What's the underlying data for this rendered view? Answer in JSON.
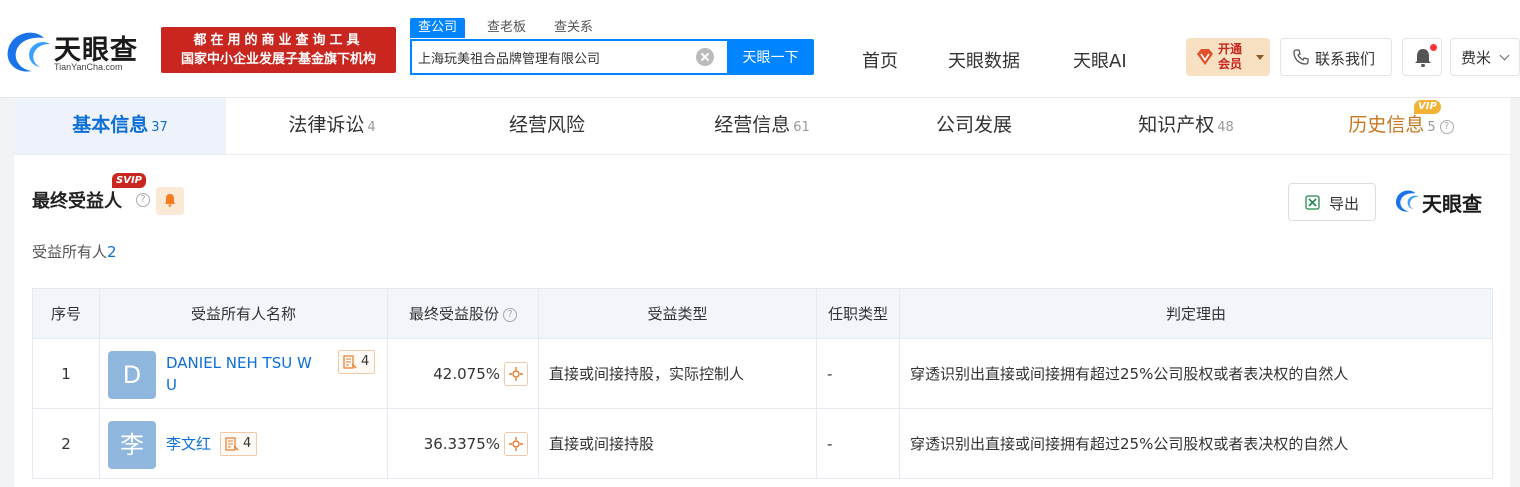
{
  "header": {
    "logo_text": "天眼查",
    "logo_sub": "TianYanCha.com",
    "slogan_line1": "都在用的商业查询工具",
    "slogan_line2": "国家中小企业发展子基金旗下机构",
    "search_tabs": [
      "查公司",
      "查老板",
      "查关系"
    ],
    "search_value": "上海玩美祖合品牌管理有限公司",
    "search_button": "天眼一下",
    "nav": [
      "首页",
      "天眼数据",
      "天眼AI"
    ],
    "vip_label": "开通会员",
    "contact_label": "联系我们",
    "user_label": "费米"
  },
  "tabs": [
    {
      "label": "基本信息",
      "count": "37"
    },
    {
      "label": "法律诉讼",
      "count": "4"
    },
    {
      "label": "经营风险",
      "count": ""
    },
    {
      "label": "经营信息",
      "count": "61"
    },
    {
      "label": "公司发展",
      "count": ""
    },
    {
      "label": "知识产权",
      "count": "48"
    },
    {
      "label": "历史信息",
      "count": "5",
      "tag": "VIP"
    }
  ],
  "section": {
    "title": "最终受益人",
    "tag": "SVIP",
    "export_label": "导出",
    "brand_text": "天眼查",
    "owner_count_label": "受益所有人",
    "owner_count": "2"
  },
  "table": {
    "headers": [
      "序号",
      "受益所有人名称",
      "最终受益股份",
      "受益类型",
      "任职类型",
      "判定理由"
    ],
    "rows": [
      {
        "index": "1",
        "avatar": "D",
        "avatar_color": "#8fb6dd",
        "name_line1": "DANIEL NEH TSU W",
        "name_line2": "U",
        "cases": "4",
        "share": "42.075%",
        "benefit_type": "直接或间接持股，实际控制人",
        "position_type": "-",
        "reason": "穿透识别出直接或间接拥有超过25%公司股权或者表决权的自然人"
      },
      {
        "index": "2",
        "avatar": "李",
        "avatar_color": "#8fb6dd",
        "name_line1": "李文红",
        "name_line2": "",
        "cases": "4",
        "share": "36.3375%",
        "benefit_type": "直接或间接持股",
        "position_type": "-",
        "reason": "穿透识别出直接或间接拥有超过25%公司股权或者表决权的自然人"
      }
    ]
  },
  "colors": {
    "accent": "#0084ff",
    "link": "#0e6fd8",
    "brand_red": "#c8261f"
  }
}
